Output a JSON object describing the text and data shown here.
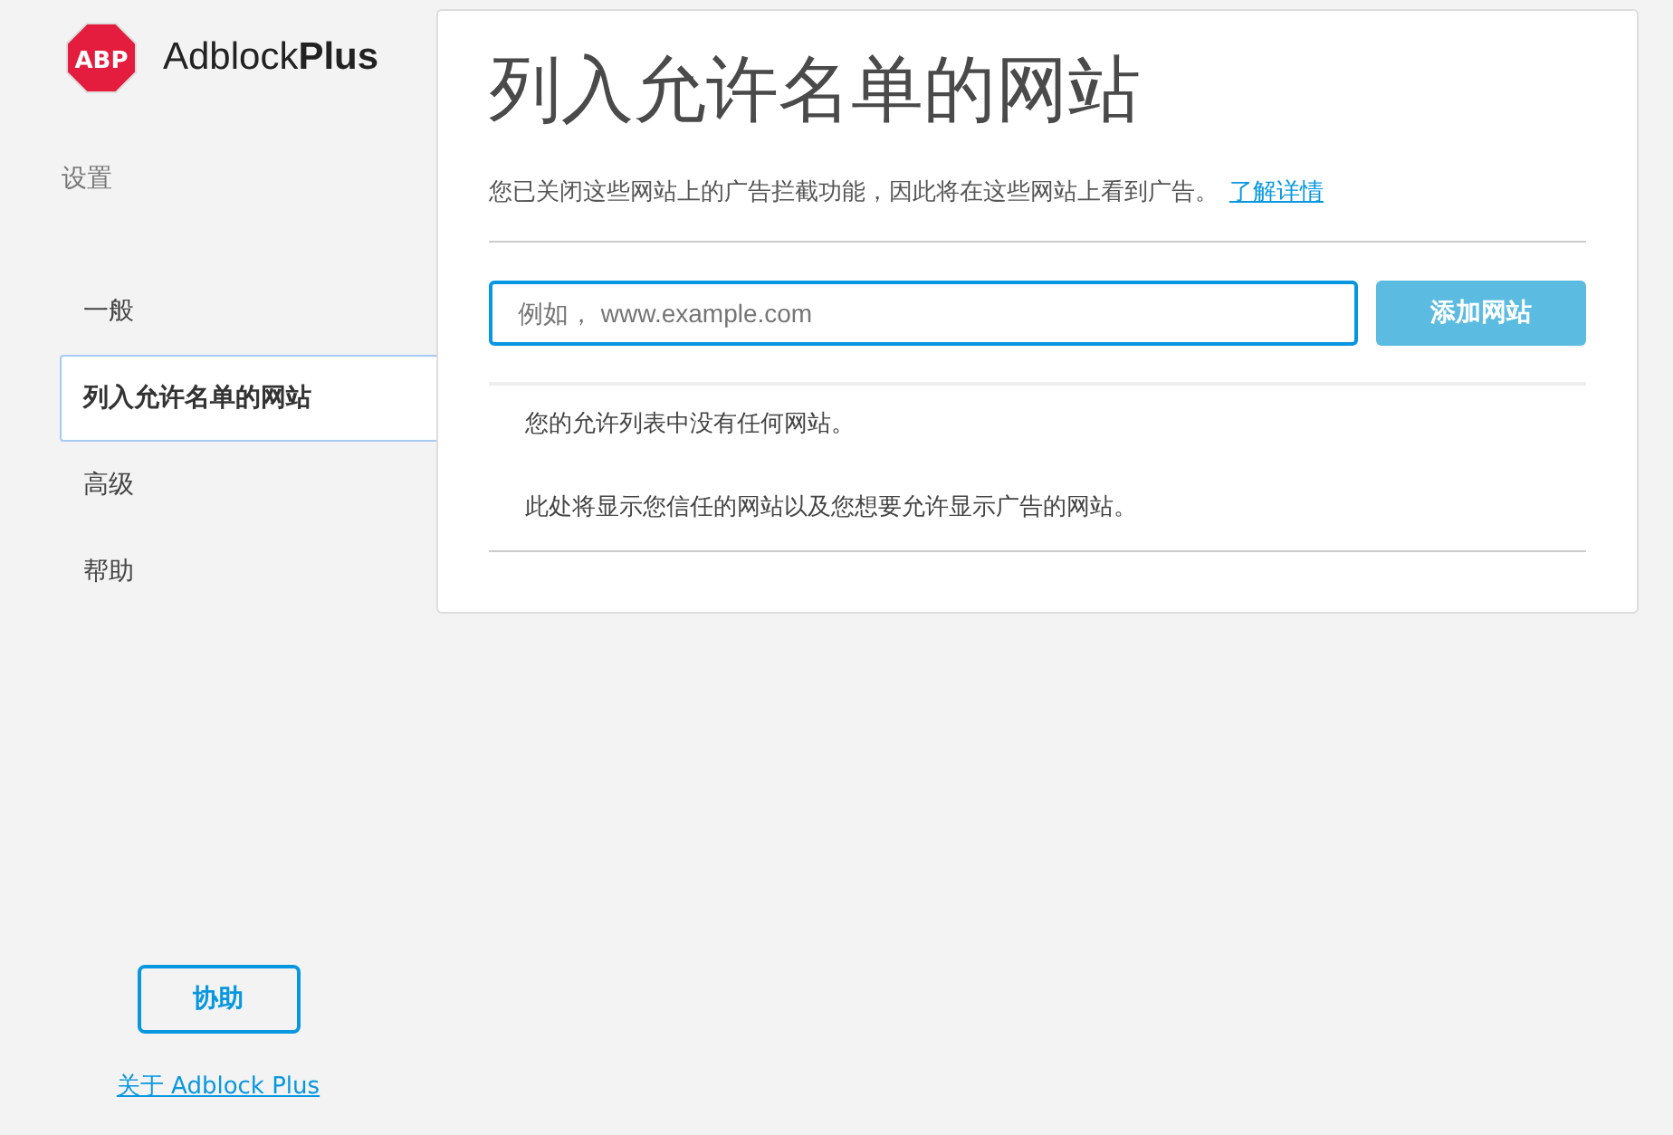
{
  "logo": {
    "badge": "ABP",
    "name": "Adblock**Plus**"
  },
  "sidebar": {
    "heading": "设置",
    "items": [
      {
        "label": "一般",
        "selected": false
      },
      {
        "label": "列入允许名单的网站",
        "selected": true
      },
      {
        "label": "高级",
        "selected": false
      },
      {
        "label": "帮助",
        "selected": false
      }
    ],
    "contribute_button": "协助",
    "about_link": "关于 Adblock Plus"
  },
  "main": {
    "title": "列入允许名单的网站",
    "description": "您已关闭这些网站上的广告拦截功能，因此将在这些网站上看到广告。",
    "learn_more_link": "了解详情",
    "search": {
      "placeholder": "例如， www.example.com"
    },
    "add_button": {
      "label": "添加网站",
      "disabled": true
    },
    "empty_messages": [
      "您的允许列表中没有任何网站。",
      "此处将显示您信任的网站以及您想要允许显示广告的网站。"
    ]
  }
}
